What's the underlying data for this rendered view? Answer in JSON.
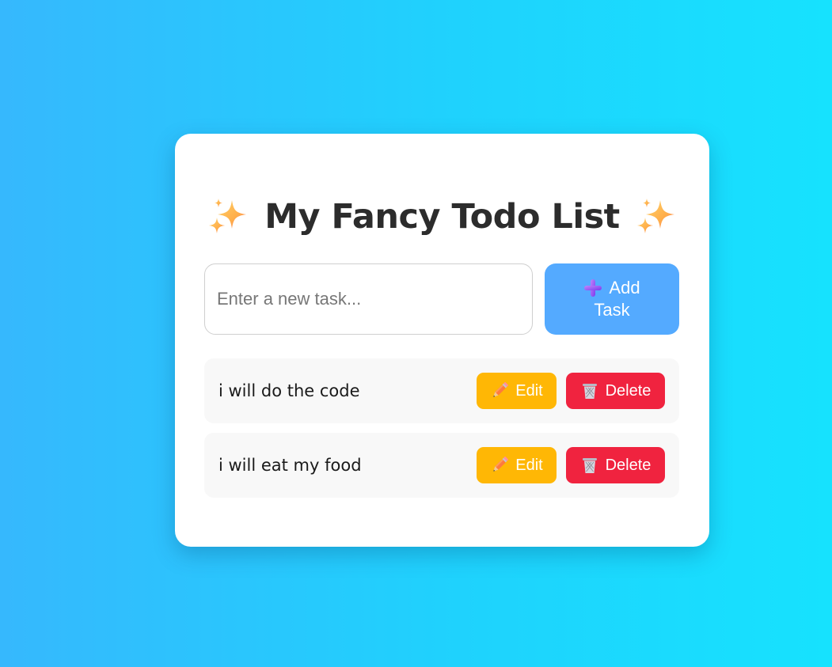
{
  "title": {
    "emoji_left": "sparkles-icon",
    "text": "My Fancy Todo List",
    "emoji_right": "sparkles-icon"
  },
  "input": {
    "placeholder": "Enter a new task...",
    "value": ""
  },
  "add_button": {
    "icon": "plus-icon",
    "label_line1": "Add",
    "label_line2": "Task"
  },
  "tasks": [
    {
      "text": "i will do the code",
      "edit_label": "Edit",
      "delete_label": "Delete"
    },
    {
      "text": "i will eat my food",
      "edit_label": "Edit",
      "delete_label": "Delete"
    }
  ],
  "icons": {
    "edit": "pencil-icon",
    "delete": "trash-icon"
  },
  "colors": {
    "background_start": "#36b8fd",
    "background_end": "#16e2fe",
    "card": "#ffffff",
    "add_button": "#54aaff",
    "edit_button": "#ffb705",
    "delete_button": "#f0233f",
    "task_row": "#f8f8f8",
    "title_text": "#2c2c2c"
  }
}
